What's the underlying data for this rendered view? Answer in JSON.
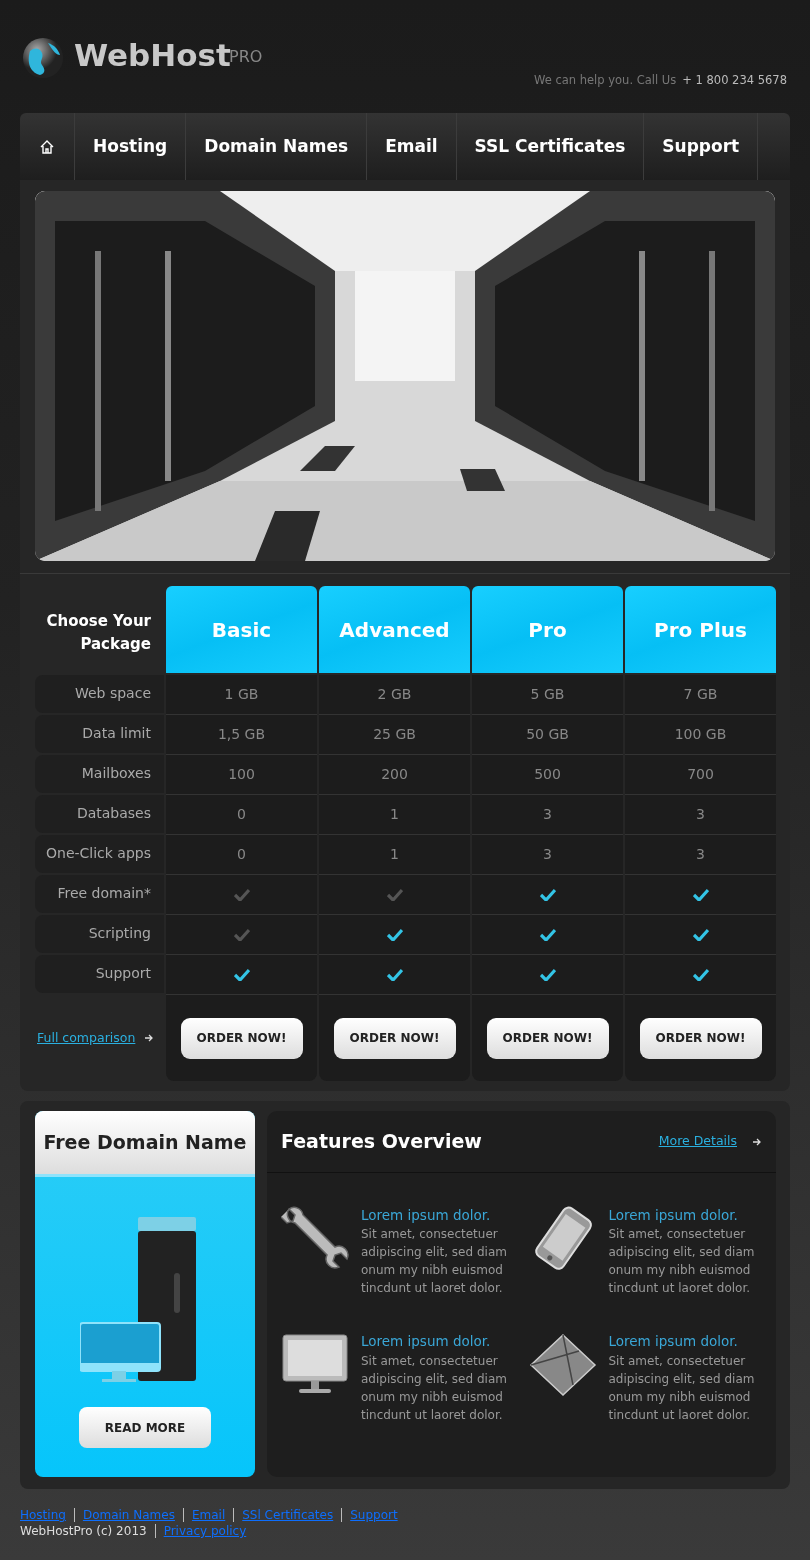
{
  "brand": {
    "name": "WebHost",
    "suffix": "PRO"
  },
  "contact": {
    "label": "We can help you. Call Us",
    "phone": "+ 1 800 234 5678"
  },
  "nav": [
    {
      "label": "Hosting",
      "selected": false
    },
    {
      "label": "Domain Names",
      "selected": false
    },
    {
      "label": "Email",
      "selected": false
    },
    {
      "label": "SSL Certificates",
      "selected": false
    },
    {
      "label": "Support",
      "selected": false
    }
  ],
  "pricing": {
    "title": "Choose Your Package",
    "plans": [
      "Basic",
      "Advanced",
      "Pro",
      "Pro Plus"
    ],
    "rows": [
      {
        "label": "Web space",
        "kind": "text",
        "cells": [
          "1 GB",
          "2 GB",
          "5 GB",
          "7 GB"
        ]
      },
      {
        "label": "Data limit",
        "kind": "text",
        "cells": [
          "1,5 GB",
          "25 GB",
          "50 GB",
          "100 GB"
        ]
      },
      {
        "label": "Mailboxes",
        "kind": "text",
        "cells": [
          "100",
          "200",
          "500",
          "700"
        ]
      },
      {
        "label": "Databases",
        "kind": "text",
        "cells": [
          "0",
          "1",
          "3",
          "3"
        ]
      },
      {
        "label": "One-Click apps",
        "kind": "text",
        "cells": [
          "0",
          "1",
          "3",
          "3"
        ]
      },
      {
        "label": "Free domain*",
        "kind": "check",
        "cells": [
          {
            "checked": false
          },
          {
            "checked": false
          },
          {
            "checked": true
          },
          {
            "checked": true
          }
        ]
      },
      {
        "label": "Scripting",
        "kind": "check",
        "cells": [
          {
            "checked": false
          },
          {
            "checked": true
          },
          {
            "checked": true
          },
          {
            "checked": true
          }
        ]
      },
      {
        "label": "Support",
        "kind": "check",
        "cells": [
          {
            "checked": true
          },
          {
            "checked": true
          },
          {
            "checked": true
          },
          {
            "checked": true
          }
        ]
      }
    ],
    "comparison_link": "Full comparison",
    "order_buttons": [
      "ORDER NOW!",
      "ORDER NOW!",
      "ORDER NOW!",
      "ORDER NOW!"
    ]
  },
  "promo": {
    "title": "Free Domain Name",
    "button": "READ MORE"
  },
  "features": {
    "title": "Features Overview",
    "more_link": "More Details",
    "items": [
      {
        "heading": "Lorem ipsum dolor.",
        "text": "Sit amet, consectetuer adipiscing elit, sed diam onum my nibh euismod tincdunt ut laoret dolor."
      },
      {
        "heading": "Lorem ipsum dolor.",
        "text": "Sit amet, consectetuer adipiscing elit, sed diam onum my nibh euismod tincdunt ut laoret dolor."
      },
      {
        "heading": "Lorem ipsum dolor.",
        "text": "Sit amet, consectetuer adipiscing elit, sed diam onum my nibh euismod tincdunt ut laoret dolor."
      },
      {
        "heading": "Lorem ipsum dolor.",
        "text": "Sit amet, consectetuer adipiscing elit, sed diam onum my nibh euismod tincdunt ut laoret dolor."
      }
    ]
  },
  "footer": {
    "links": [
      "Hosting",
      "Domain Names",
      "Email",
      "SSl Certificates",
      "Support"
    ],
    "copyright": "WebHostPro (c) 2013",
    "privacy": "Privacy policy"
  }
}
